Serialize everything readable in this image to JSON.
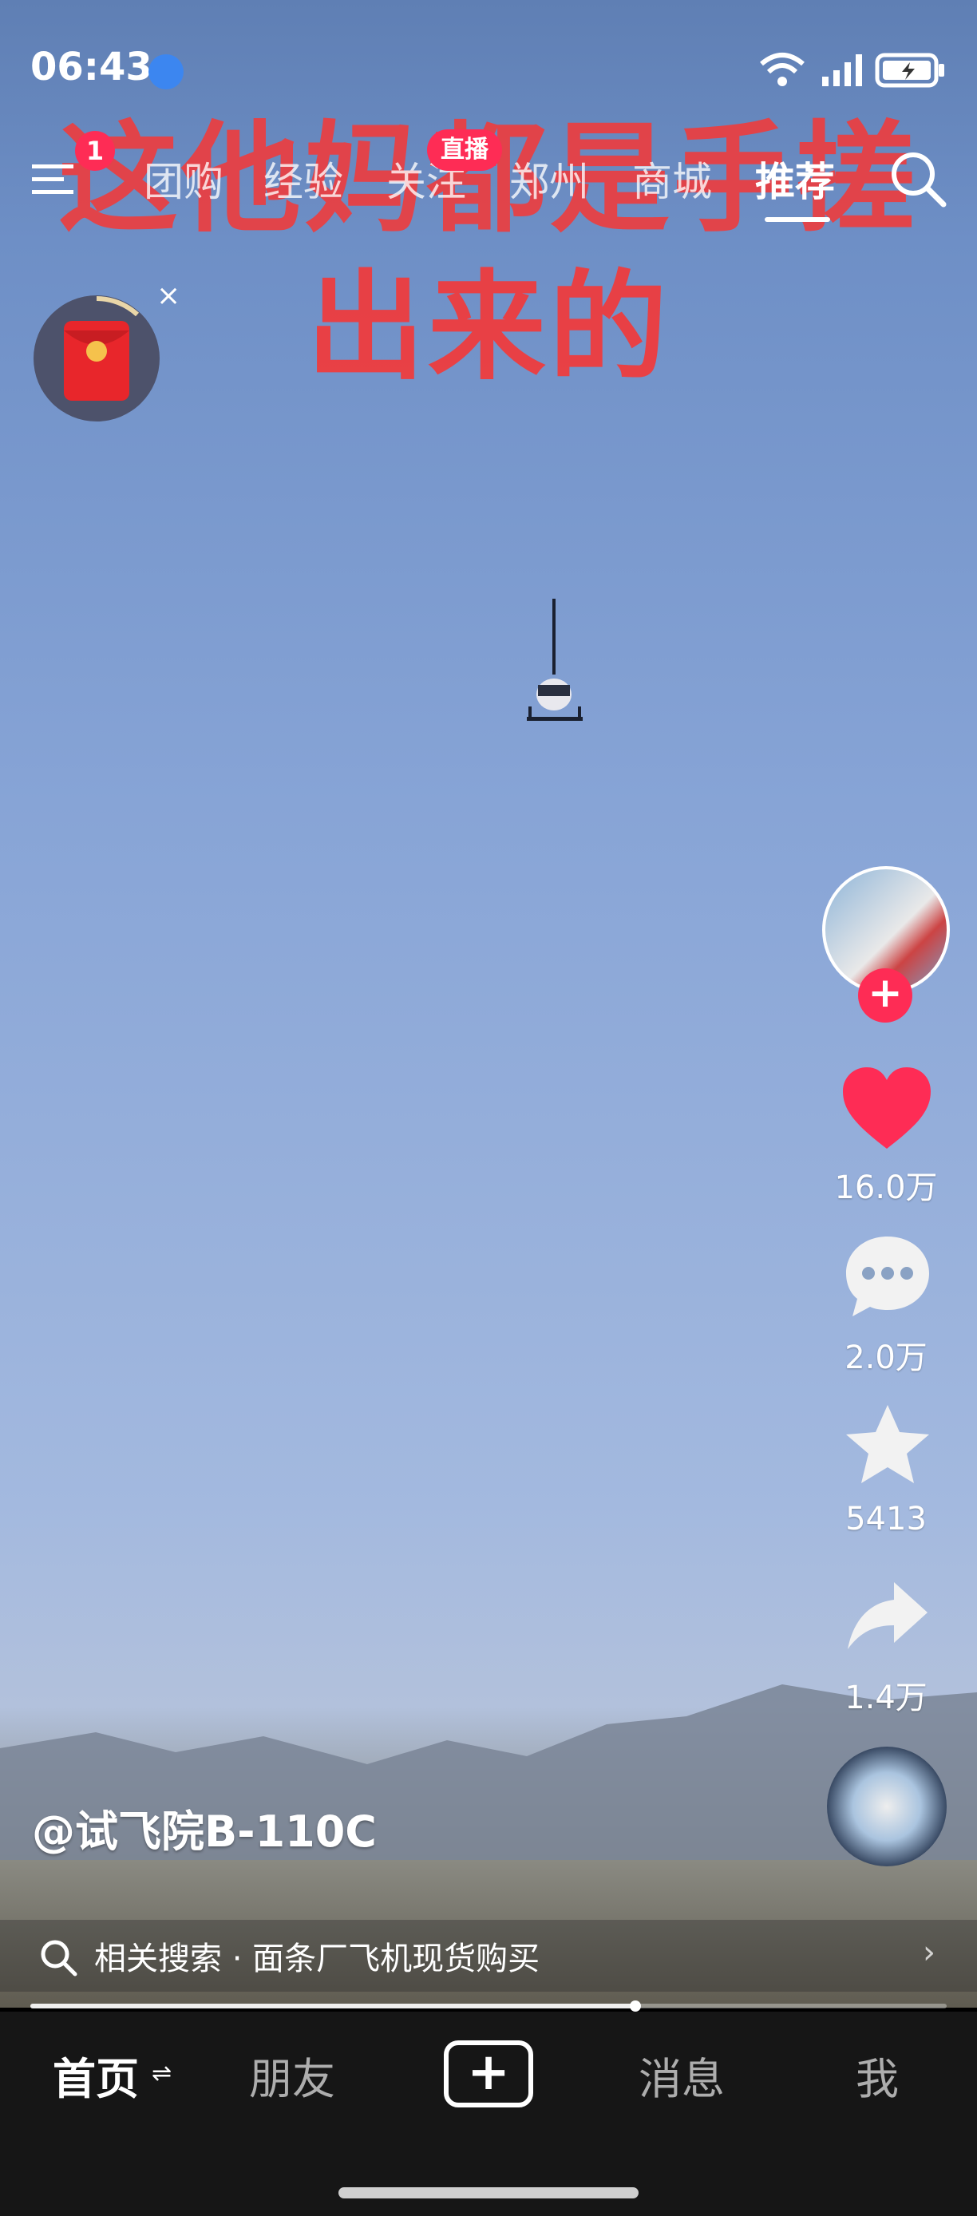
{
  "status_bar": {
    "time": "06:43",
    "icons": [
      "message-icon",
      "wifi-icon",
      "signal-icon",
      "battery-icon"
    ]
  },
  "top_nav": {
    "menu_badge": "1",
    "tabs": [
      "团购",
      "经验",
      "关注",
      "郑州",
      "商城",
      "推荐"
    ],
    "active_tab": "推荐",
    "live_badge": "直播"
  },
  "video": {
    "overlay_line1": "这他妈都是手搓",
    "overlay_line2": "出来的",
    "author": "@试飞院B-110C",
    "related_search": "相关搜索 · 面条厂飞机现货购买",
    "progress": 0.66
  },
  "actions": {
    "likes": "16.0万",
    "comments": "2.0万",
    "favorites": "5413",
    "shares": "1.4万"
  },
  "bottom_nav": {
    "home": "首页",
    "friends": "朋友",
    "messages": "消息",
    "me": "我",
    "home_switch": "⇌"
  },
  "colors": {
    "accent": "#fe2c55",
    "overlay_red": "#f23a3a",
    "nav_bg": "#161616"
  }
}
